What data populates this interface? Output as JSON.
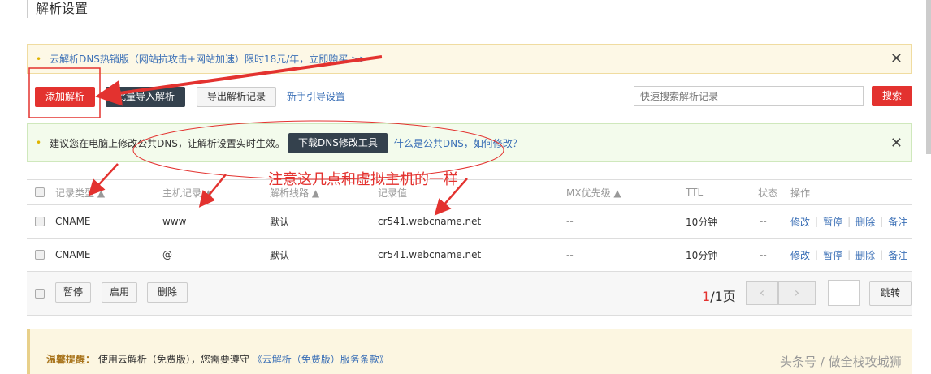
{
  "page_title": "解析设置",
  "promo": {
    "text": "云解析DNS热销版（网站抗攻击+网站加速）限时18元/年，立即购买 >>"
  },
  "toolbar": {
    "add": "添加解析",
    "import": "批量导入解析",
    "export": "导出解析记录",
    "guide": "新手引导设置",
    "search_placeholder": "快速搜索解析记录",
    "search": "搜索"
  },
  "tip": {
    "text": "建议您在电脑上修改公共DNS，让解析设置实时生效。",
    "download": "下载DNS修改工具",
    "link": "什么是公共DNS，如何修改？"
  },
  "annotation": "注意这几点和虚拟主机的一样",
  "table": {
    "headers": [
      "记录类型 ▲",
      "主机记录 ▲",
      "解析线路 ▲",
      "记录值",
      "MX优先级 ▲",
      "TTL",
      "状态",
      "操作"
    ],
    "rows": [
      {
        "type": "CNAME",
        "host": "www",
        "line": "默认",
        "value": "cr541.webcname.net",
        "mx": "--",
        "ttl": "10分钟",
        "status": "--"
      },
      {
        "type": "CNAME",
        "host": "@",
        "line": "默认",
        "value": "cr541.webcname.net",
        "mx": "--",
        "ttl": "10分钟",
        "status": "--"
      }
    ],
    "ops": [
      "修改",
      "暂停",
      "删除",
      "备注"
    ]
  },
  "footer": {
    "pause": "暂停",
    "enable": "启用",
    "delete": "删除",
    "page_current": "1",
    "page_total": "/1页",
    "prev": "‹",
    "next": "›",
    "jump": "跳转"
  },
  "warning": {
    "label": "温馨提醒：",
    "text": "使用云解析（免费版），您需要遵守",
    "link": "《云解析（免费版）服务条款》"
  },
  "watermark": "头条号 / 做全栈攻城狮",
  "colors": {
    "accent_red": "#e3322f",
    "dark": "#34414d",
    "link": "#3a6fb6"
  }
}
